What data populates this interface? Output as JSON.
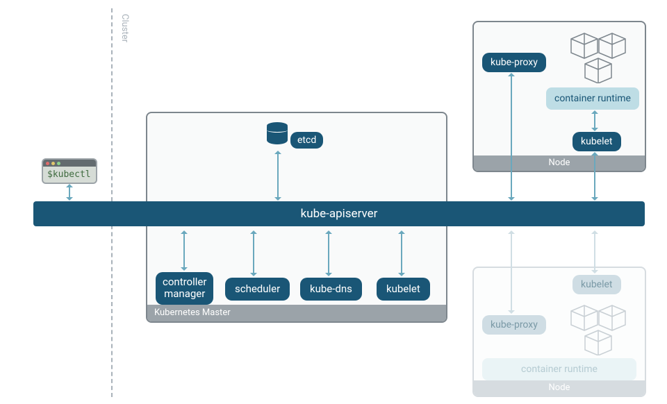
{
  "cluster_label": "Cluster",
  "kubectl": {
    "prompt": "$kubectl"
  },
  "apiserver": "kube-apiserver",
  "master": {
    "label": "Kubernetes Master",
    "etcd": "etcd",
    "components": {
      "controller": "controller\nmanager",
      "scheduler": "scheduler",
      "kubedns": "kube-dns",
      "kubelet": "kubelet"
    }
  },
  "node": {
    "label": "Node",
    "kubeproxy": "kube-proxy",
    "runtime": "container runtime",
    "kubelet": "kubelet"
  }
}
